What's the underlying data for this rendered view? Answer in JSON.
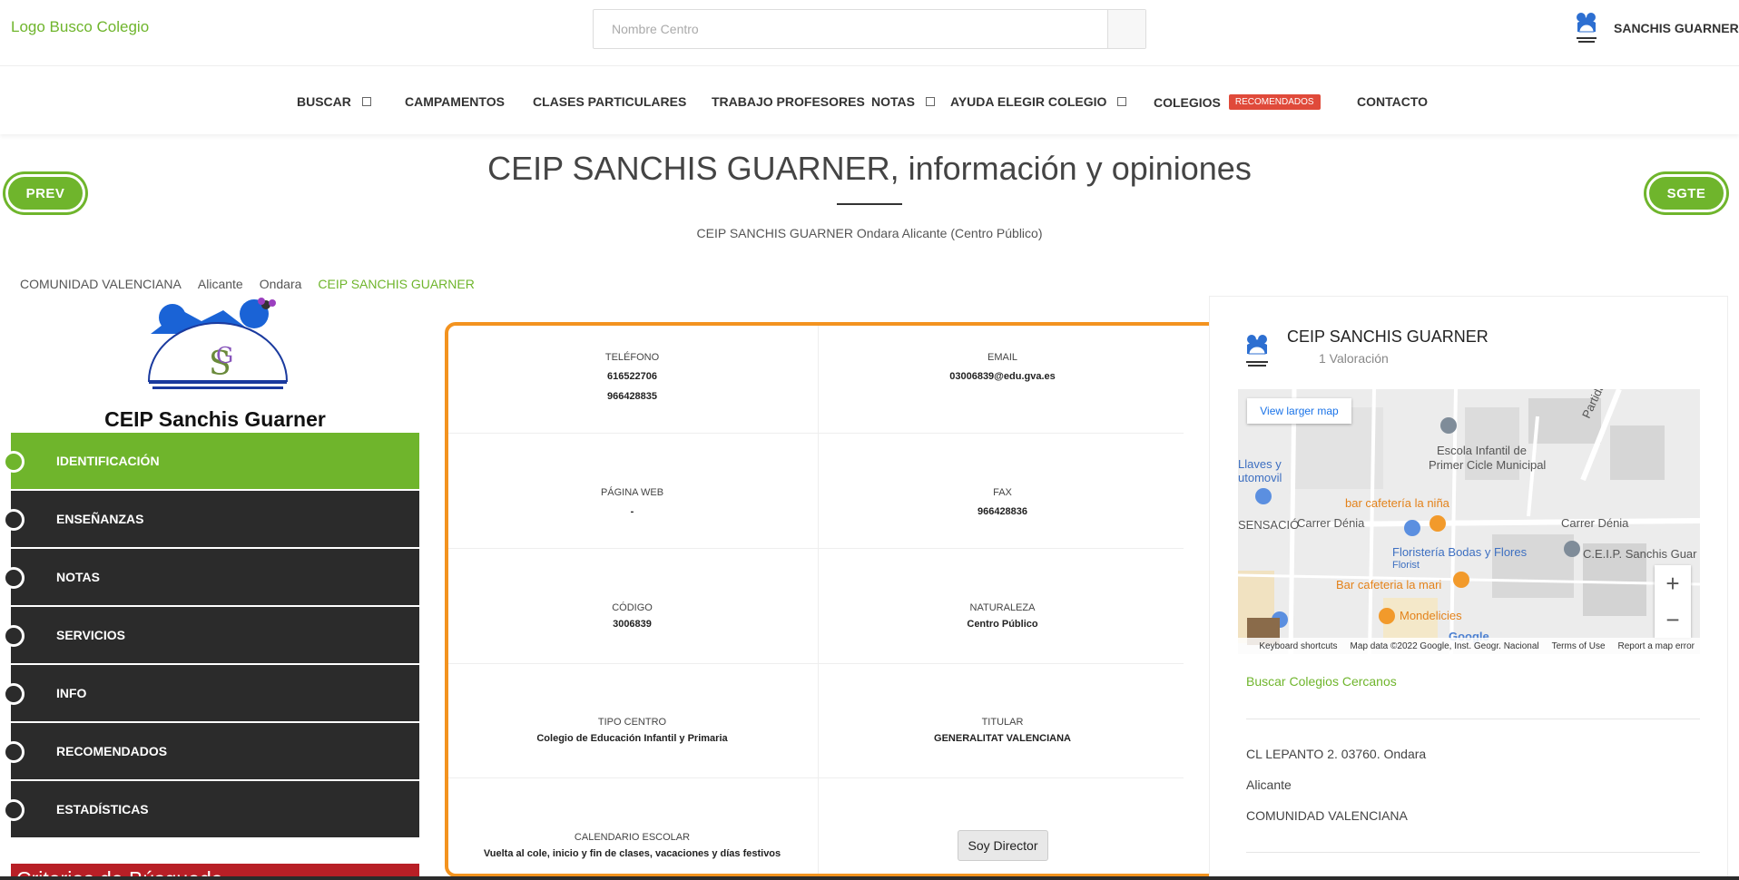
{
  "header": {
    "logo_text": "Logo Busco Colegio",
    "search_placeholder": "Nombre Centro",
    "user_name": "SANCHIS GUARNER"
  },
  "nav": {
    "items": [
      {
        "label": "BUSCAR",
        "dropdown": true
      },
      {
        "label": "CAMPAMENTOS"
      },
      {
        "label": "CLASES PARTICULARES"
      },
      {
        "label": "TRABAJO PROFESORES"
      },
      {
        "label": "NOTAS",
        "dropdown": true
      },
      {
        "label": "AYUDA ELEGIR COLEGIO",
        "dropdown": true
      },
      {
        "label": "COLEGIOS",
        "badge": "RECOMENDADOS"
      },
      {
        "label": "CONTACTO"
      }
    ]
  },
  "page": {
    "title": "CEIP SANCHIS GUARNER, información y opiniones",
    "subtitle": "CEIP SANCHIS GUARNER Ondara Alicante (Centro Público)",
    "prev_label": "PREV",
    "next_label": "SGTE"
  },
  "breadcrumb": [
    "COMUNIDAD VALENCIANA",
    "Alicante",
    "Ondara",
    "CEIP SANCHIS GUARNER"
  ],
  "sidebar": {
    "school_caption": "CEIP Sanchis Guarner",
    "items": [
      {
        "label": "IDENTIFICACIÓN",
        "active": true
      },
      {
        "label": "ENSEÑANZAS"
      },
      {
        "label": "NOTAS"
      },
      {
        "label": "SERVICIOS"
      },
      {
        "label": "INFO"
      },
      {
        "label": "RECOMENDADOS"
      },
      {
        "label": "ESTADÍSTICAS"
      }
    ],
    "criteria_label": "Criterios de Búsqueda"
  },
  "info": {
    "telefono_label": "TELÉFONO",
    "telefono_1": "616522706",
    "telefono_2": "966428835",
    "email_label": "EMAIL",
    "email_value": "03006839@edu.gva.es",
    "web_label": "PÁGINA WEB",
    "web_value": "-",
    "fax_label": "FAX",
    "fax_value": "966428836",
    "codigo_label": "CÓDIGO",
    "codigo_value": "3006839",
    "naturaleza_label": "NATURALEZA",
    "naturaleza_value": "Centro Público",
    "tipo_label": "TIPO CENTRO",
    "tipo_value": "Colegio de Educación Infantil y Primaria",
    "titular_label": "TITULAR",
    "titular_value": "GENERALITAT VALENCIANA",
    "calendario_label": "CALENDARIO ESCOLAR",
    "calendario_value": "Vuelta al cole, inicio y fin de clases, vacaciones y días festivos",
    "director_button": "Soy Director"
  },
  "card": {
    "title": "CEIP SANCHIS GUARNER",
    "rating": "1 Valoración",
    "map": {
      "view_larger": "View larger map",
      "labels": {
        "escuela": "Escola Infantil de",
        "escuela2": "Primer Cicle Municipal",
        "llaves": "Llaves y",
        "automovil": "utomovil",
        "bar_nina": "bar cafetería la niña",
        "carrer_denia_1": "Carrer Dénia",
        "carrer_denia_2": "Carrer Dénia",
        "sensacio": "SENSACIÓ",
        "floristeria": "Floristería Bodas y Flores",
        "florist": "Florist",
        "ceip": "C.E.I.P. Sanchis Guar",
        "bar_mari": "Bar cafeteria la mari",
        "mondelicies": "Mondelicies",
        "partida": "Partida Alfat",
        "google": "Google"
      },
      "footer": [
        "Keyboard shortcuts",
        "Map data ©2022 Google, Inst. Geogr. Nacional",
        "Terms of Use",
        "Report a map error"
      ]
    },
    "near_link": "Buscar Colegios Cercanos",
    "address_1": "CL LEPANTO 2. 03760. Ondara",
    "address_2": "Alicante",
    "address_3": "COMUNIDAD VALENCIANA"
  },
  "colors": {
    "brand_green": "#6fb52c",
    "sidebar_dark": "#2b2b2b",
    "badge_red": "#e04a3a",
    "box_orange": "#f3931f",
    "criteria_red": "#b81f26"
  }
}
